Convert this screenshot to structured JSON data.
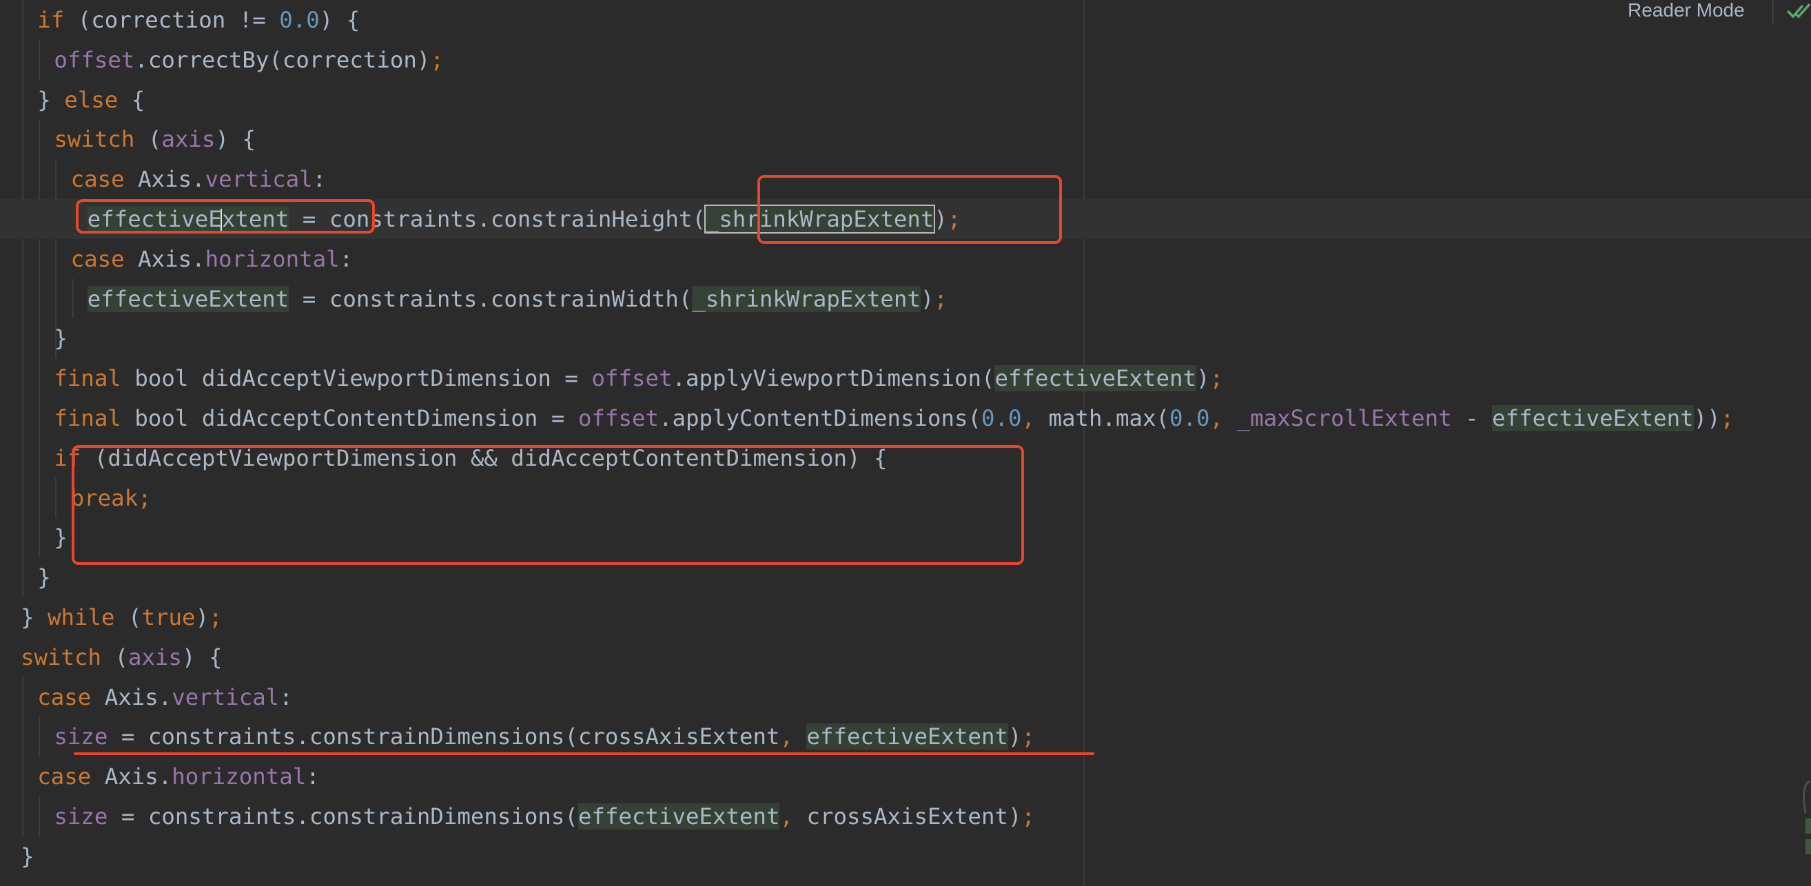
{
  "editor": {
    "status": {
      "reader_mode": "Reader Mode",
      "check_icon": "check-icon"
    },
    "colors": {
      "background": "#2b2b2b",
      "keyword": "#cc7832",
      "number": "#6897bb",
      "field": "#9876aa",
      "text": "#a9b7c6",
      "usage_highlight": "#344134",
      "annotation": "#e8442e"
    },
    "lines": [
      [
        [
          "if",
          "kw"
        ],
        [
          " (correction != ",
          ""
        ],
        [
          "0.0",
          "num"
        ],
        [
          ") {",
          ""
        ]
      ],
      [
        [
          "offset",
          "fld"
        ],
        [
          ".correctBy(correction)",
          ""
        ],
        [
          ";",
          "punc"
        ]
      ],
      [
        [
          "} ",
          ""
        ],
        [
          "else",
          "kw"
        ],
        [
          " {",
          ""
        ]
      ],
      [
        [
          "switch",
          "kw"
        ],
        [
          " (",
          ""
        ],
        [
          "axis",
          "fld"
        ],
        [
          ") {",
          ""
        ]
      ],
      [
        [
          "case",
          "kw"
        ],
        [
          " Axis.",
          ""
        ],
        [
          "vertical",
          "fld"
        ],
        [
          ":",
          ""
        ]
      ],
      [
        [
          "effectiveE",
          "hl"
        ],
        [
          "",
          "caret"
        ],
        [
          "xtent",
          "hl"
        ],
        [
          " = constraints.constrainHeight(",
          ""
        ],
        [
          "_shrinkWrapExtent",
          "hlbox"
        ],
        [
          ")",
          ""
        ],
        [
          ";",
          "punc"
        ]
      ],
      [
        [
          "case",
          "kw"
        ],
        [
          " Axis.",
          ""
        ],
        [
          "horizontal",
          "fld"
        ],
        [
          ":",
          ""
        ]
      ],
      [
        [
          "effectiveExtent",
          "hl"
        ],
        [
          " = constraints.constrainWidth(",
          ""
        ],
        [
          "_shrinkWrapExtent",
          "hl"
        ],
        [
          ")",
          ""
        ],
        [
          ";",
          "punc"
        ]
      ],
      [
        [
          "}",
          ""
        ]
      ],
      [
        [
          "final",
          "kw"
        ],
        [
          " bool didAcceptViewportDimension = ",
          ""
        ],
        [
          "offset",
          "fld"
        ],
        [
          ".applyViewportDimension(",
          ""
        ],
        [
          "effectiveExtent",
          "hl"
        ],
        [
          ")",
          ""
        ],
        [
          ";",
          "punc"
        ]
      ],
      [
        [
          "final",
          "kw"
        ],
        [
          " bool didAcceptContentDimension = ",
          ""
        ],
        [
          "offset",
          "fld"
        ],
        [
          ".applyContentDimensions(",
          ""
        ],
        [
          "0.0",
          "num"
        ],
        [
          ", ",
          "punc"
        ],
        [
          "math.max(",
          ""
        ],
        [
          "0.0",
          "num"
        ],
        [
          ", ",
          "punc"
        ],
        [
          "_maxScrollExtent",
          "fld"
        ],
        [
          " - ",
          ""
        ],
        [
          "effectiveExtent",
          "hl"
        ],
        [
          "))",
          ""
        ],
        [
          ";",
          "punc"
        ]
      ],
      [
        [
          "if",
          "kw"
        ],
        [
          " (didAcceptViewportDimension && didAcceptContentDimension) {",
          ""
        ]
      ],
      [
        [
          "break",
          "kw"
        ],
        [
          ";",
          "punc"
        ]
      ],
      [
        [
          "}",
          ""
        ]
      ],
      [
        [
          "}",
          ""
        ]
      ],
      [
        [
          "} ",
          ""
        ],
        [
          "while",
          "kw"
        ],
        [
          " (",
          ""
        ],
        [
          "true",
          "kw"
        ],
        [
          ")",
          ""
        ],
        [
          ";",
          "punc"
        ]
      ],
      [
        [
          "switch",
          "kw"
        ],
        [
          " (",
          ""
        ],
        [
          "axis",
          "fld"
        ],
        [
          ") {",
          ""
        ]
      ],
      [
        [
          "case",
          "kw"
        ],
        [
          " Axis.",
          ""
        ],
        [
          "vertical",
          "fld"
        ],
        [
          ":",
          ""
        ]
      ],
      [
        [
          "size",
          "fld"
        ],
        [
          " = constraints.constrainDimensions(crossAxisExtent",
          ""
        ],
        [
          ", ",
          "punc"
        ],
        [
          "effectiveExtent",
          "hl"
        ],
        [
          ")",
          ""
        ],
        [
          ";",
          "punc"
        ]
      ],
      [
        [
          "case",
          "kw"
        ],
        [
          " Axis.",
          ""
        ],
        [
          "horizontal",
          "fld"
        ],
        [
          ":",
          ""
        ]
      ],
      [
        [
          "size",
          "fld"
        ],
        [
          " = constraints.constrainDimensions(",
          ""
        ],
        [
          "effectiveExtent",
          "hl"
        ],
        [
          ", ",
          "punc"
        ],
        [
          "crossAxisExtent)",
          ""
        ],
        [
          ";",
          "punc"
        ]
      ],
      [
        [
          "}",
          ""
        ]
      ]
    ]
  }
}
